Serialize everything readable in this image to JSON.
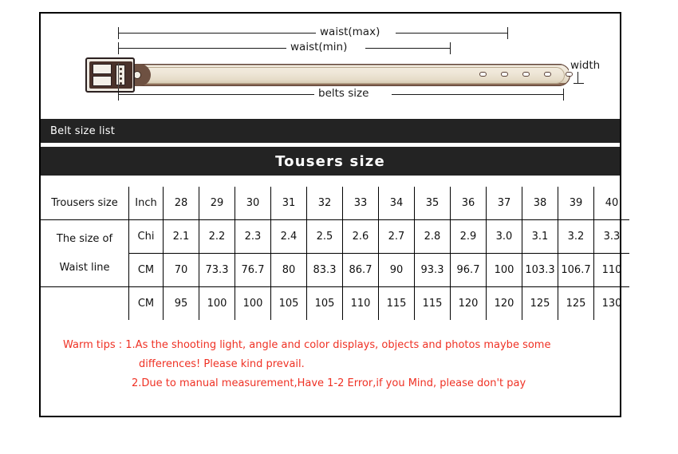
{
  "diagram": {
    "labels": {
      "waist_max": "waist(max)",
      "waist_min": "waist(min)",
      "belts_size": "belts size",
      "width": "width"
    },
    "belt": {
      "hole_count": 5
    }
  },
  "bars": {
    "belt_size_list": "Belt size list",
    "trousers_size": "Tousers  size"
  },
  "table": {
    "row_trousers_label": "Trousers size",
    "row_waist_label_line1": "The size of",
    "row_waist_label_line2": "Waist line",
    "units": {
      "inch": "Inch",
      "chi": "Chi",
      "cm": "CM",
      "cm2": "CM"
    },
    "inch_sizes": [
      "28",
      "29",
      "30",
      "31",
      "32",
      "33",
      "34",
      "35",
      "36",
      "37",
      "38",
      "39",
      "40"
    ],
    "chi_values": [
      "2.1",
      "2.2",
      "2.3",
      "2.4",
      "2.5",
      "2.6",
      "2.7",
      "2.8",
      "2.9",
      "3.0",
      "3.1",
      "3.2",
      "3.3"
    ],
    "cm_values": [
      "70",
      "73.3",
      "76.7",
      "80",
      "83.3",
      "86.7",
      "90",
      "93.3",
      "96.7",
      "100",
      "103.3",
      "106.7",
      "110"
    ],
    "belt_cm_values": [
      "95",
      "100",
      "100",
      "105",
      "105",
      "110",
      "115",
      "115",
      "120",
      "120",
      "125",
      "125",
      "130"
    ]
  },
  "tips": {
    "line1": "Warm tips : 1.As the shooting light, angle and color displays, objects and photos maybe some",
    "line2": "differences! Please kind prevail.",
    "line3": "2.Due to manual measurement,Have 1-2 Error,if you Mind, please  don't pay"
  },
  "colors": {
    "bar_background": "#232323",
    "tips_text": "#ef3124",
    "belt_leather": "#efe7d8",
    "belt_buckle": "#4a322a",
    "border": "#000000"
  }
}
